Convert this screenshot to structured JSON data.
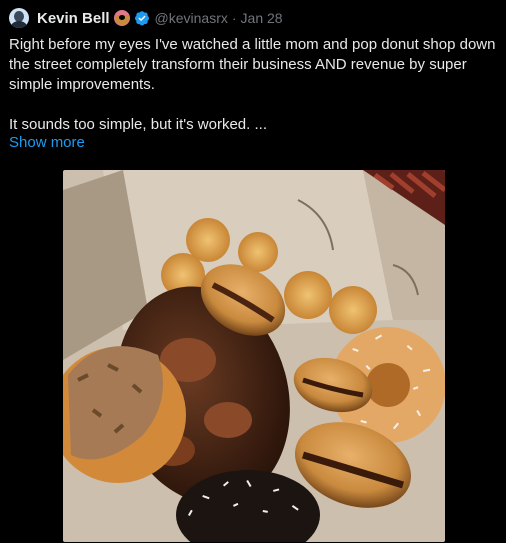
{
  "tweet": {
    "author": {
      "display_name": "Kevin Bell",
      "handle": "@kevinasrx",
      "verified": true,
      "name_emoji": "donut-emoji",
      "avatar_icon": "avatar-photo"
    },
    "separator": "·",
    "date": "Jan 28",
    "paragraphs": [
      "Right before my eyes I've watched a little mom and pop donut shop down the street completely transform their business AND revenue by super simple improvements.",
      "It sounds too simple, but it's worked. ..."
    ],
    "show_more_label": "Show more",
    "media": {
      "kind": "photo",
      "subject": "donut-box-photo"
    }
  },
  "colors": {
    "background": "#000000",
    "text_primary": "#e7e9ea",
    "text_secondary": "#71767b",
    "link": "#1d9bf0",
    "verified_badge": "#1d9bf0"
  }
}
